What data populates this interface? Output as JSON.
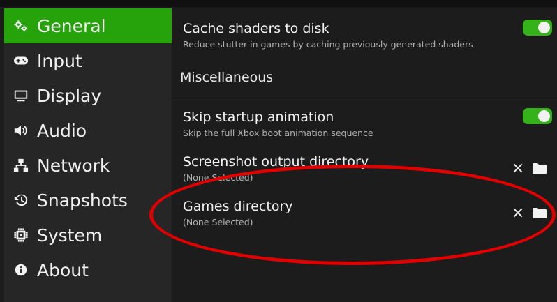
{
  "sidebar": {
    "items": [
      {
        "label": "General",
        "icon": "gears-icon",
        "active": true
      },
      {
        "label": "Input",
        "icon": "gamepad-icon"
      },
      {
        "label": "Display",
        "icon": "monitor-icon"
      },
      {
        "label": "Audio",
        "icon": "speaker-icon"
      },
      {
        "label": "Network",
        "icon": "network-icon"
      },
      {
        "label": "Snapshots",
        "icon": "history-icon"
      },
      {
        "label": "System",
        "icon": "chip-icon"
      },
      {
        "label": "About",
        "icon": "info-icon"
      }
    ]
  },
  "main": {
    "cache": {
      "title": "Cache shaders to disk",
      "desc": "Reduce stutter in games by caching previously generated shaders",
      "enabled": true
    },
    "section": "Miscellaneous",
    "skip": {
      "title": "Skip startup animation",
      "desc": "Skip the full Xbox boot animation sequence",
      "enabled": true
    },
    "screenshot": {
      "title": "Screenshot output directory",
      "value": "(None Selected)"
    },
    "games": {
      "title": "Games directory",
      "value": "(None Selected)"
    }
  },
  "colors": {
    "accent": "#26a20b",
    "toggle_on": "#35b21a",
    "annotation": "#e00000"
  }
}
